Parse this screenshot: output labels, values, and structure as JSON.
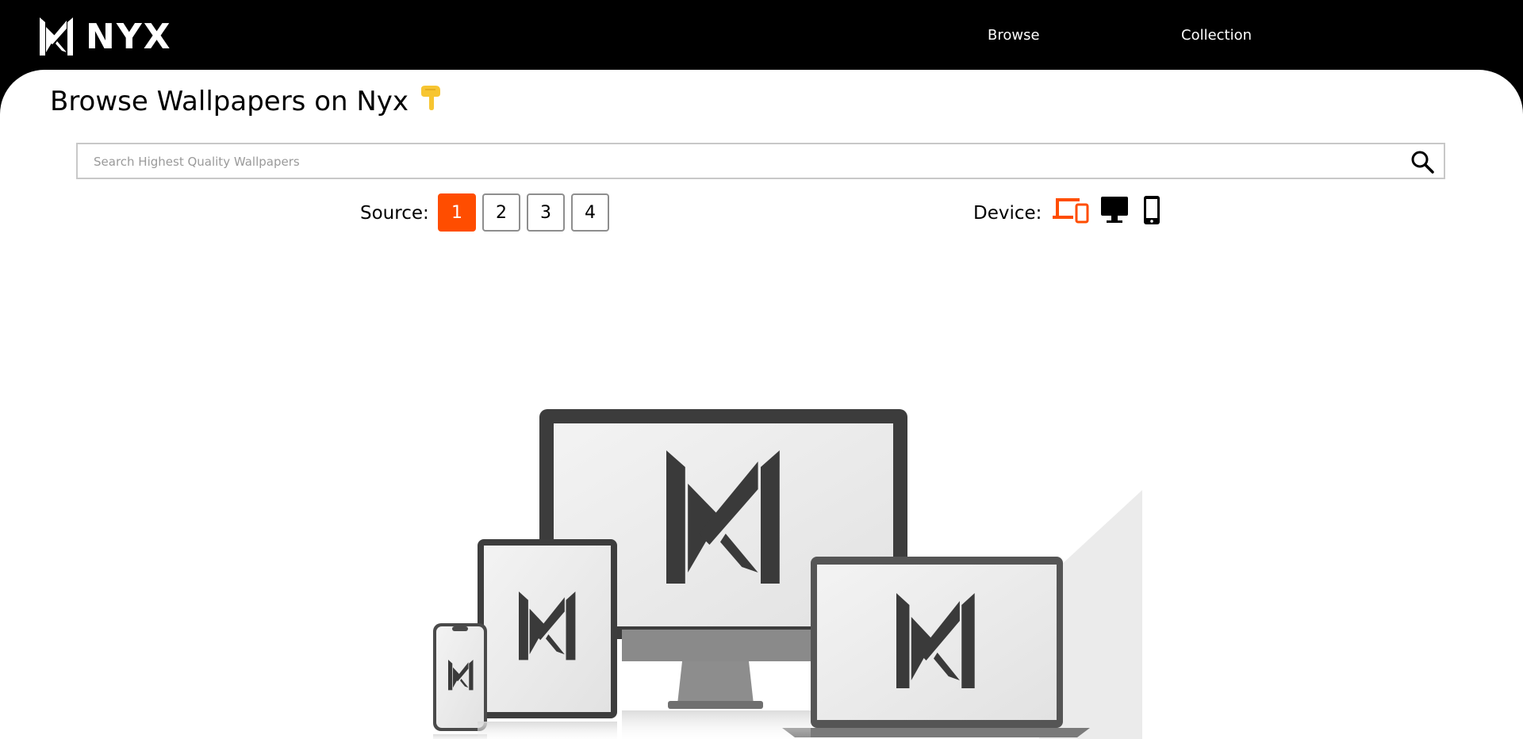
{
  "brand": {
    "name": "NYX"
  },
  "nav": {
    "items": [
      {
        "label": "Browse"
      },
      {
        "label": "Collection"
      }
    ]
  },
  "page": {
    "title": "Browse Wallpapers on Nyx",
    "title_emoji": "pointing-down-hand-icon"
  },
  "search": {
    "placeholder": "Search Highest Quality Wallpapers",
    "value": "",
    "icon": "search-icon"
  },
  "source": {
    "label": "Source:",
    "options": [
      "1",
      "2",
      "3",
      "4"
    ],
    "selected": "1"
  },
  "device": {
    "label": "Device:",
    "options": [
      {
        "name": "all-devices",
        "icon": "multi-device-icon",
        "selected": true
      },
      {
        "name": "desktop",
        "icon": "desktop-icon",
        "selected": false
      },
      {
        "name": "mobile",
        "icon": "phone-icon",
        "selected": false
      }
    ]
  },
  "colors": {
    "accent": "#ff4d00",
    "topbar": "#000000",
    "panel": "#ffffff",
    "emoji": "#f7c531"
  }
}
